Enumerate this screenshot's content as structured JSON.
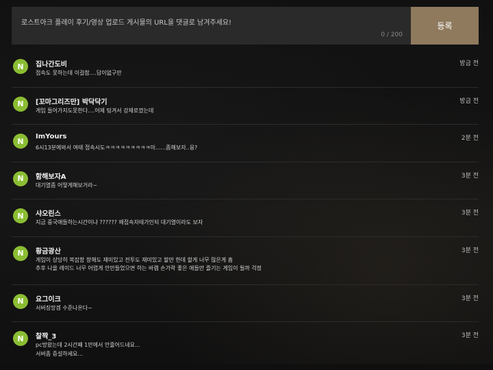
{
  "form": {
    "placeholder": "로스트아크 플레이 후기/영상 업로드 게시물의 URL을 댓글로 남겨주세요!",
    "char_count": "0 / 200",
    "submit_label": "등록"
  },
  "comments": [
    {
      "avatar": "N",
      "author": "집나간도비",
      "time": "방금 전",
      "lines": [
        "접속도 못하는데 이걸참....답이없구만"
      ]
    },
    {
      "avatar": "N",
      "author": "[꼬마그리즈만] 박닥닥기",
      "time": "방금 전",
      "lines": [
        "게임 들어가지도못한다....어제 팅겨서 강제로껐는데"
      ]
    },
    {
      "avatar": "N",
      "author": "ImYours",
      "time": "2분 전",
      "lines": [
        "6시13분에와서 여태 접속시도ㅋㅋㅋㅋㅋㅋㅋㅋㅋ아......좀해보자..응?"
      ]
    },
    {
      "avatar": "N",
      "author": "함해보자A",
      "time": "3분 전",
      "lines": [
        "대기열좀 어떻게해보거라~"
      ]
    },
    {
      "avatar": "N",
      "author": "샤오린스",
      "time": "3분 전",
      "lines": [
        "지금 중국애들하는시간이냐 ?????? 왜접속자테가인되 대기열이라도 보자"
      ]
    },
    {
      "avatar": "N",
      "author": "황금광산",
      "time": "3분 전",
      "lines": [
        "게임이 상당히 복잡함 항해도 재미있고 전투도 재미있고 할만 한데 할게 너무 많은게 흠",
        "추후 나올 레이드 너무 어렵게 안만들었으면 하는 바램 손가락 좋은 애들만 즐기는 게임이 될까 걱정"
      ]
    },
    {
      "avatar": "N",
      "author": "요그이크",
      "time": "3분 전",
      "lines": [
        "서버징망겜 수준나온다~"
      ]
    },
    {
      "avatar": "N",
      "author": "찰짝_3",
      "time": "3분 전",
      "lines": [
        "pc방왔는데 2시간째 1만에서 안줄어드네요...",
        "서버좀 증설하세요..."
      ]
    }
  ]
}
